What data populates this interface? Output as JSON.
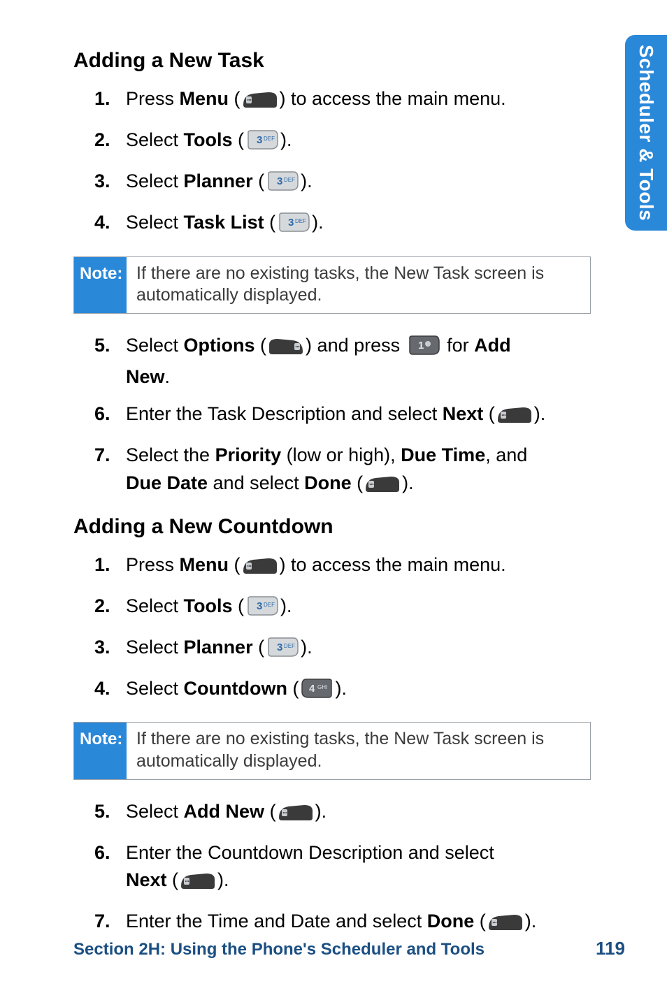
{
  "sideTab": "Scheduler & Tools",
  "section1": {
    "heading": "Adding a New Task",
    "stepsA": [
      {
        "pre": "Press ",
        "bold": "Menu",
        "post": " to access the main menu.",
        "icon": "softkey-left"
      },
      {
        "pre": "Select ",
        "bold": "Tools",
        "post": ".",
        "icon": "key3"
      },
      {
        "pre": "Select ",
        "bold": "Planner",
        "post": ".",
        "icon": "key3"
      },
      {
        "pre": "Select ",
        "bold": "Task List",
        "post": ".",
        "icon": "key3"
      }
    ],
    "note": {
      "label": "Note:",
      "text": "If there are no existing tasks, the New Task screen is automatically displayed."
    },
    "step5": {
      "selectWord": "Select ",
      "options": "Options",
      "andPress": " and press ",
      "forWord": " for ",
      "addNew": "Add New",
      "dot": "."
    },
    "step6": {
      "pre": "Enter the Task Description and select ",
      "next": "Next",
      "post": "."
    },
    "step7": {
      "a": "Select the ",
      "priority": "Priority",
      "b": " (low or high), ",
      "dueTime": "Due Time",
      "c": ", and ",
      "dueDate": "Due Date",
      "d": " and select ",
      "done": "Done",
      "e": "."
    }
  },
  "section2": {
    "heading": "Adding a New Countdown",
    "stepsA": [
      {
        "pre": "Press ",
        "bold": "Menu",
        "post": " to access the main menu.",
        "icon": "softkey-left"
      },
      {
        "pre": "Select ",
        "bold": "Tools",
        "post": ".",
        "icon": "key3"
      },
      {
        "pre": "Select ",
        "bold": "Planner",
        "post": ".",
        "icon": "key3"
      },
      {
        "pre": "Select ",
        "bold": "Countdown",
        "post": ".",
        "icon": "key4"
      }
    ],
    "note": {
      "label": "Note:",
      "text": "If there are no existing tasks, the New Task screen is automatically displayed."
    },
    "step5": {
      "pre": "Select ",
      "bold": "Add New",
      "post": "."
    },
    "step6": {
      "pre": "Enter the Countdown Description and select ",
      "next": "Next",
      "post": "."
    },
    "step7": {
      "pre": "Enter the Time and Date and select ",
      "done": "Done",
      "post": "."
    }
  },
  "footer": {
    "left": "Section 2H: Using the Phone's Scheduler and Tools",
    "page": "119"
  }
}
